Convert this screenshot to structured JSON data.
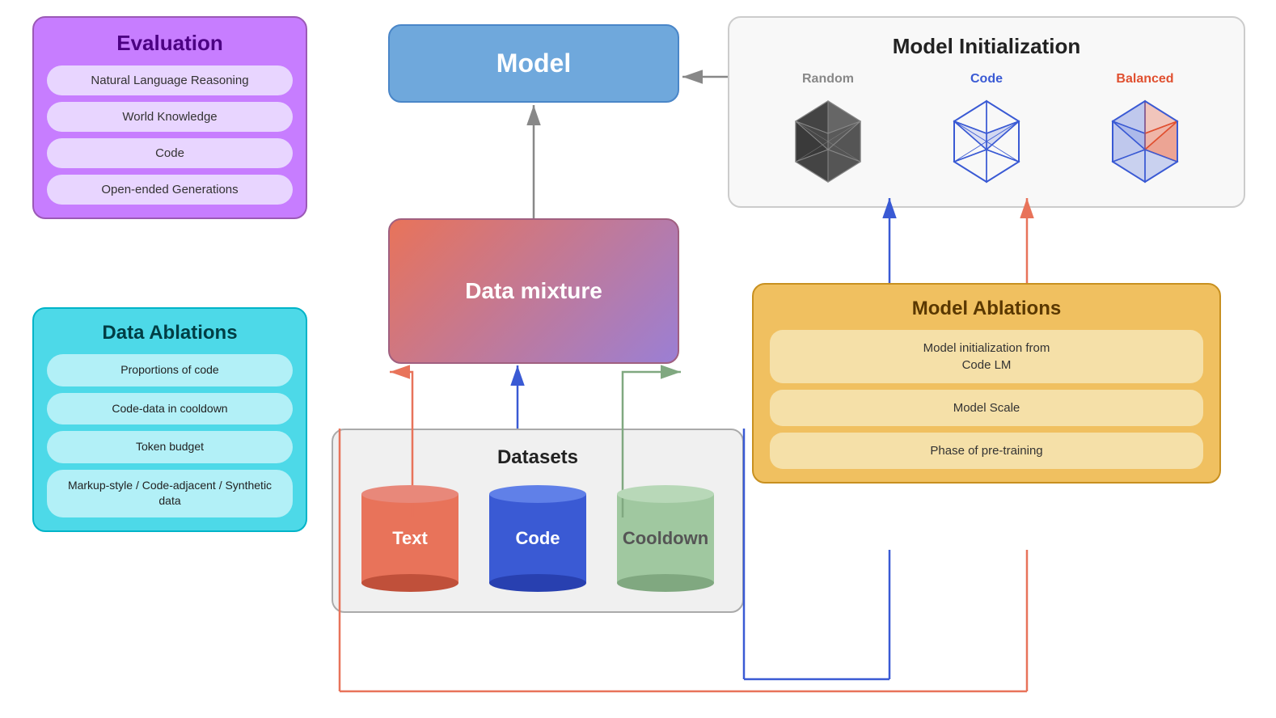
{
  "evaluation": {
    "title": "Evaluation",
    "items": [
      "Natural Language Reasoning",
      "World Knowledge",
      "Code",
      "Open-ended Generations"
    ]
  },
  "data_ablations_left": {
    "title": "Data Ablations",
    "items": [
      "Proportions of code",
      "Code-data in cooldown",
      "Token budget",
      "Markup-style / Code-adjacent / Synthetic data"
    ]
  },
  "model_box": {
    "title": "Model"
  },
  "data_mixture_box": {
    "title": "Data mixture"
  },
  "datasets_box": {
    "title": "Datasets",
    "cylinders": [
      {
        "label": "Text",
        "type": "text"
      },
      {
        "label": "Code",
        "type": "code"
      },
      {
        "label": "Cooldown",
        "type": "cooldown"
      }
    ]
  },
  "model_init": {
    "title": "Model Initialization",
    "options": [
      {
        "label": "Random",
        "color_class": "label-random"
      },
      {
        "label": "Code",
        "color_class": "label-code"
      },
      {
        "label": "Balanced",
        "color_class": "label-balanced"
      }
    ]
  },
  "model_ablations_right": {
    "title": "Model Ablations",
    "items": [
      "Model initialization from\nCode LM",
      "Model Scale",
      "Phase of pre-training"
    ]
  }
}
